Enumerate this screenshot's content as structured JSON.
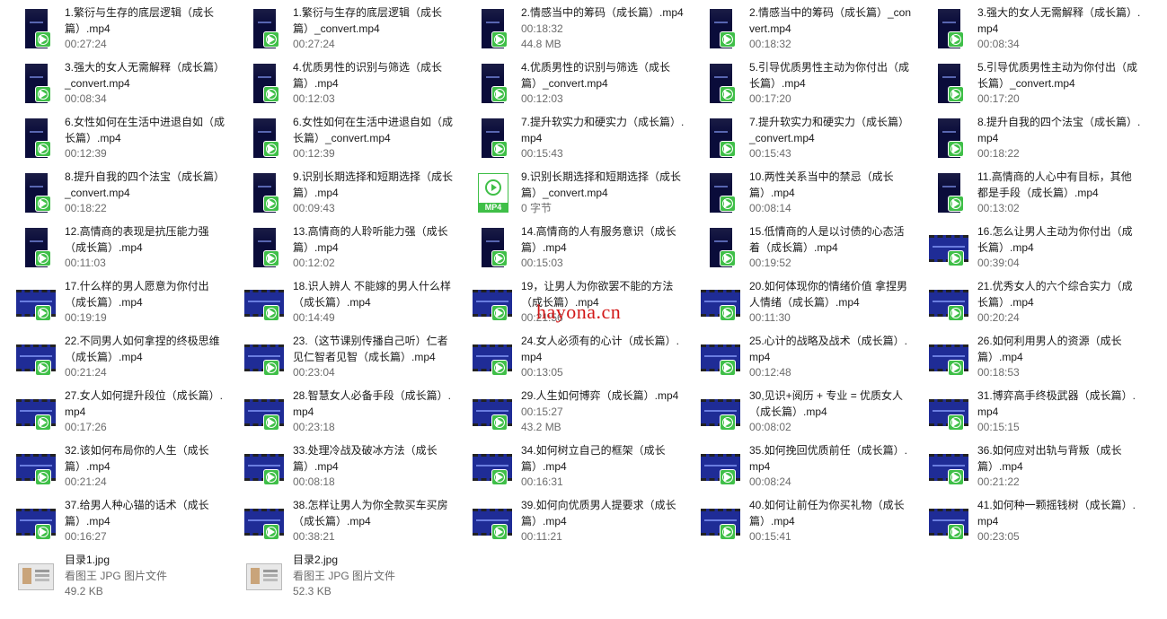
{
  "watermark": "hayona.cn",
  "colors": {
    "badge": "#3fbf48",
    "thumb_bg": "#0b0f58",
    "watermark": "#d21818"
  },
  "files": [
    {
      "name": "1.繁衍与生存的底层逻辑（成长篇）.mp4",
      "meta1": "00:27:24",
      "meta2": "",
      "thumb": "portrait"
    },
    {
      "name": "1.繁衍与生存的底层逻辑（成长篇）_convert.mp4",
      "meta1": "00:27:24",
      "meta2": "",
      "thumb": "portrait"
    },
    {
      "name": "2.情感当中的筹码（成长篇）.mp4",
      "meta1": "00:18:32",
      "meta2": "44.8 MB",
      "thumb": "portrait"
    },
    {
      "name": "2.情感当中的筹码（成长篇）_convert.mp4",
      "meta1": "00:18:32",
      "meta2": "",
      "thumb": "portrait"
    },
    {
      "name": "3.强大的女人无需解释（成长篇）.mp4",
      "meta1": "00:08:34",
      "meta2": "",
      "thumb": "portrait"
    },
    {
      "name": "3.强大的女人无需解释（成长篇）_convert.mp4",
      "meta1": "00:08:34",
      "meta2": "",
      "thumb": "portrait"
    },
    {
      "name": "4.优质男性的识别与筛选（成长篇）.mp4",
      "meta1": "00:12:03",
      "meta2": "",
      "thumb": "portrait"
    },
    {
      "name": "4.优质男性的识别与筛选（成长篇）_convert.mp4",
      "meta1": "00:12:03",
      "meta2": "",
      "thumb": "portrait"
    },
    {
      "name": "5.引导优质男性主动为你付出（成长篇）.mp4",
      "meta1": "00:17:20",
      "meta2": "",
      "thumb": "portrait"
    },
    {
      "name": "5.引导优质男性主动为你付出（成长篇）_convert.mp4",
      "meta1": "00:17:20",
      "meta2": "",
      "thumb": "portrait"
    },
    {
      "name": "6.女性如何在生活中进退自如（成长篇）.mp4",
      "meta1": "00:12:39",
      "meta2": "",
      "thumb": "portrait"
    },
    {
      "name": "6.女性如何在生活中进退自如（成长篇）_convert.mp4",
      "meta1": "00:12:39",
      "meta2": "",
      "thumb": "portrait"
    },
    {
      "name": "7.提升软实力和硬实力（成长篇）.mp4",
      "meta1": "00:15:43",
      "meta2": "",
      "thumb": "portrait"
    },
    {
      "name": "7.提升软实力和硬实力（成长篇）_convert.mp4",
      "meta1": "00:15:43",
      "meta2": "",
      "thumb": "portrait"
    },
    {
      "name": "8.提升自我的四个法宝（成长篇）.mp4",
      "meta1": "00:18:22",
      "meta2": "",
      "thumb": "portrait"
    },
    {
      "name": "8.提升自我的四个法宝（成长篇）_convert.mp4",
      "meta1": "00:18:22",
      "meta2": "",
      "thumb": "portrait"
    },
    {
      "name": "9.识别长期选择和短期选择（成长篇）.mp4",
      "meta1": "00:09:43",
      "meta2": "",
      "thumb": "portrait"
    },
    {
      "name": "9.识别长期选择和短期选择（成长篇）_convert.mp4",
      "meta1": "0 字节",
      "meta2": "",
      "thumb": "mp4icon",
      "icon_label": "MP4"
    },
    {
      "name": "10.两性关系当中的禁忌（成长篇）.mp4",
      "meta1": "00:08:14",
      "meta2": "",
      "thumb": "portrait"
    },
    {
      "name": "11.高情商的人心中有目标，其他都是手段（成长篇）.mp4",
      "meta1": "00:13:02",
      "meta2": "",
      "thumb": "portrait"
    },
    {
      "name": "12.高情商的表现是抗压能力强（成长篇）.mp4",
      "meta1": "00:11:03",
      "meta2": "",
      "thumb": "portrait"
    },
    {
      "name": "13.高情商的人聆听能力强（成长篇）.mp4",
      "meta1": "00:12:02",
      "meta2": "",
      "thumb": "portrait"
    },
    {
      "name": "14.高情商的人有服务意识（成长篇）.mp4",
      "meta1": "00:15:03",
      "meta2": "",
      "thumb": "portrait"
    },
    {
      "name": "15.低情商的人是以讨债的心态活着（成长篇）.mp4",
      "meta1": "00:19:52",
      "meta2": "",
      "thumb": "portrait"
    },
    {
      "name": "16.怎么让男人主动为你付出（成长篇）.mp4",
      "meta1": "00:39:04",
      "meta2": "",
      "thumb": "landscape"
    },
    {
      "name": "17.什么样的男人愿意为你付出（成长篇）.mp4",
      "meta1": "00:19:19",
      "meta2": "",
      "thumb": "landscape"
    },
    {
      "name": "18.识人辨人 不能嫁的男人什么样（成长篇）.mp4",
      "meta1": "00:14:49",
      "meta2": "",
      "thumb": "landscape"
    },
    {
      "name": "19，让男人为你欲罢不能的方法（成长篇）.mp4",
      "meta1": "00:21:56",
      "meta2": "",
      "thumb": "landscape"
    },
    {
      "name": "20.如何体现你的情绪价值 拿捏男人情绪（成长篇）.mp4",
      "meta1": "00:11:30",
      "meta2": "",
      "thumb": "landscape"
    },
    {
      "name": "21.优秀女人的六个综合实力（成长篇）.mp4",
      "meta1": "00:20:24",
      "meta2": "",
      "thumb": "landscape"
    },
    {
      "name": "22.不同男人如何拿捏的终极思维（成长篇）.mp4",
      "meta1": "00:21:24",
      "meta2": "",
      "thumb": "landscape"
    },
    {
      "name": "23.（这节课别传播自己听）仁者见仁智者见智（成长篇）.mp4",
      "meta1": "00:23:04",
      "meta2": "",
      "thumb": "landscape"
    },
    {
      "name": "24.女人必须有的心计（成长篇）.mp4",
      "meta1": "00:13:05",
      "meta2": "",
      "thumb": "landscape"
    },
    {
      "name": "25.心计的战略及战术（成长篇）.mp4",
      "meta1": "00:12:48",
      "meta2": "",
      "thumb": "landscape"
    },
    {
      "name": "26.如何利用男人的资源（成长篇）.mp4",
      "meta1": "00:18:53",
      "meta2": "",
      "thumb": "landscape"
    },
    {
      "name": "27.女人如何提升段位（成长篇）.mp4",
      "meta1": "00:17:26",
      "meta2": "",
      "thumb": "landscape"
    },
    {
      "name": "28.智慧女人必备手段（成长篇）.mp4",
      "meta1": "00:23:18",
      "meta2": "",
      "thumb": "landscape"
    },
    {
      "name": "29.人生如何博弈（成长篇）.mp4",
      "meta1": "00:15:27",
      "meta2": "43.2 MB",
      "thumb": "landscape"
    },
    {
      "name": "30,见识+阅历 + 专业 = 优质女人（成长篇）.mp4",
      "meta1": "00:08:02",
      "meta2": "",
      "thumb": "landscape"
    },
    {
      "name": "31.博弈高手终极武器（成长篇）.mp4",
      "meta1": "00:15:15",
      "meta2": "",
      "thumb": "landscape"
    },
    {
      "name": "32.该如何布局你的人生（成长篇）.mp4",
      "meta1": "00:21:24",
      "meta2": "",
      "thumb": "landscape"
    },
    {
      "name": "33.处理冷战及破冰方法（成长篇）.mp4",
      "meta1": "00:08:18",
      "meta2": "",
      "thumb": "landscape"
    },
    {
      "name": "34.如何树立自己的框架（成长篇）.mp4",
      "meta1": "00:16:31",
      "meta2": "",
      "thumb": "landscape"
    },
    {
      "name": "35.如何挽回优质前任（成长篇）.mp4",
      "meta1": "00:08:24",
      "meta2": "",
      "thumb": "landscape"
    },
    {
      "name": "36.如何应对出轨与背叛（成长篇）.mp4",
      "meta1": "00:21:22",
      "meta2": "",
      "thumb": "landscape"
    },
    {
      "name": "37.给男人种心锚的话术（成长篇）.mp4",
      "meta1": "00:16:27",
      "meta2": "",
      "thumb": "landscape"
    },
    {
      "name": "38.怎样让男人为你全款买车买房（成长篇）.mp4",
      "meta1": "00:38:21",
      "meta2": "",
      "thumb": "landscape"
    },
    {
      "name": "39.如何向优质男人提要求（成长篇）.mp4",
      "meta1": "00:11:21",
      "meta2": "",
      "thumb": "landscape"
    },
    {
      "name": "40.如何让前任为你买礼物（成长篇）.mp4",
      "meta1": "00:15:41",
      "meta2": "",
      "thumb": "landscape"
    },
    {
      "name": "41.如何种一颗摇钱树（成长篇）.mp4",
      "meta1": "00:23:05",
      "meta2": "",
      "thumb": "landscape"
    },
    {
      "name": "目录1.jpg",
      "meta1": "看图王 JPG 图片文件",
      "meta2": "49.2 KB",
      "thumb": "jpgicon"
    },
    {
      "name": "目录2.jpg",
      "meta1": "看图王 JPG 图片文件",
      "meta2": "52.3 KB",
      "thumb": "jpgicon"
    }
  ]
}
